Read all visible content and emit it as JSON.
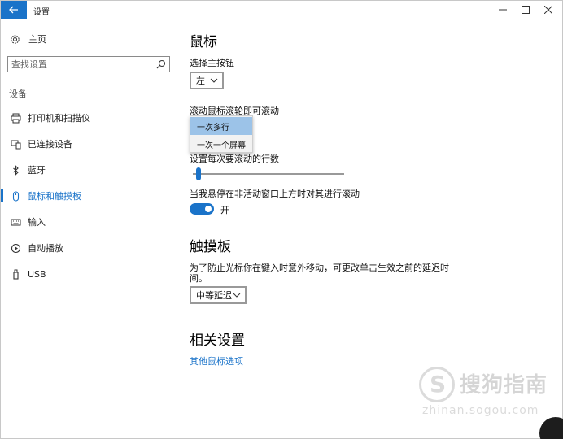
{
  "window": {
    "title": "设置",
    "controls": {
      "minimize": "—",
      "maximize": "☐",
      "close": "✕"
    }
  },
  "sidebar": {
    "home_label": "主页",
    "search_placeholder": "查找设置",
    "section_label": "设备",
    "items": [
      {
        "label": "打印机和扫描仪",
        "icon": "printer-icon"
      },
      {
        "label": "已连接设备",
        "icon": "devices-icon"
      },
      {
        "label": "蓝牙",
        "icon": "bluetooth-icon"
      },
      {
        "label": "鼠标和触摸板",
        "icon": "mouse-icon",
        "active": true
      },
      {
        "label": "输入",
        "icon": "keyboard-icon"
      },
      {
        "label": "自动播放",
        "icon": "autoplay-icon"
      },
      {
        "label": "USB",
        "icon": "usb-icon"
      }
    ]
  },
  "main": {
    "mouse_title": "鼠标",
    "primary_button_label": "选择主按钮",
    "primary_button_value": "左",
    "scroll_label": "滚动鼠标滚轮即可滚动",
    "scroll_options": [
      "一次多行",
      "一次一个屏幕"
    ],
    "scroll_selected": "一次多行",
    "lines_label": "设置每次要滚动的行数",
    "lines_value_fraction": 0.02,
    "inactive_scroll_label": "当我悬停在非活动窗口上方时对其进行滚动",
    "inactive_scroll_state": "开",
    "touchpad_title": "触摸板",
    "touchpad_desc_line1": "为了防止光标你在键入时意外移动，可更改单击生效之前的延迟时",
    "touchpad_desc_line2": "间。",
    "touchpad_delay_value": "中等延迟",
    "related_title": "相关设置",
    "related_link": "其他鼠标选项"
  },
  "watermark": {
    "logo_glyph": "S",
    "text": "搜狗指南",
    "subtext": "zhinan.sogou.com"
  },
  "colors": {
    "accent": "#1a73c9",
    "popup_selected": "#9cc3e8"
  }
}
